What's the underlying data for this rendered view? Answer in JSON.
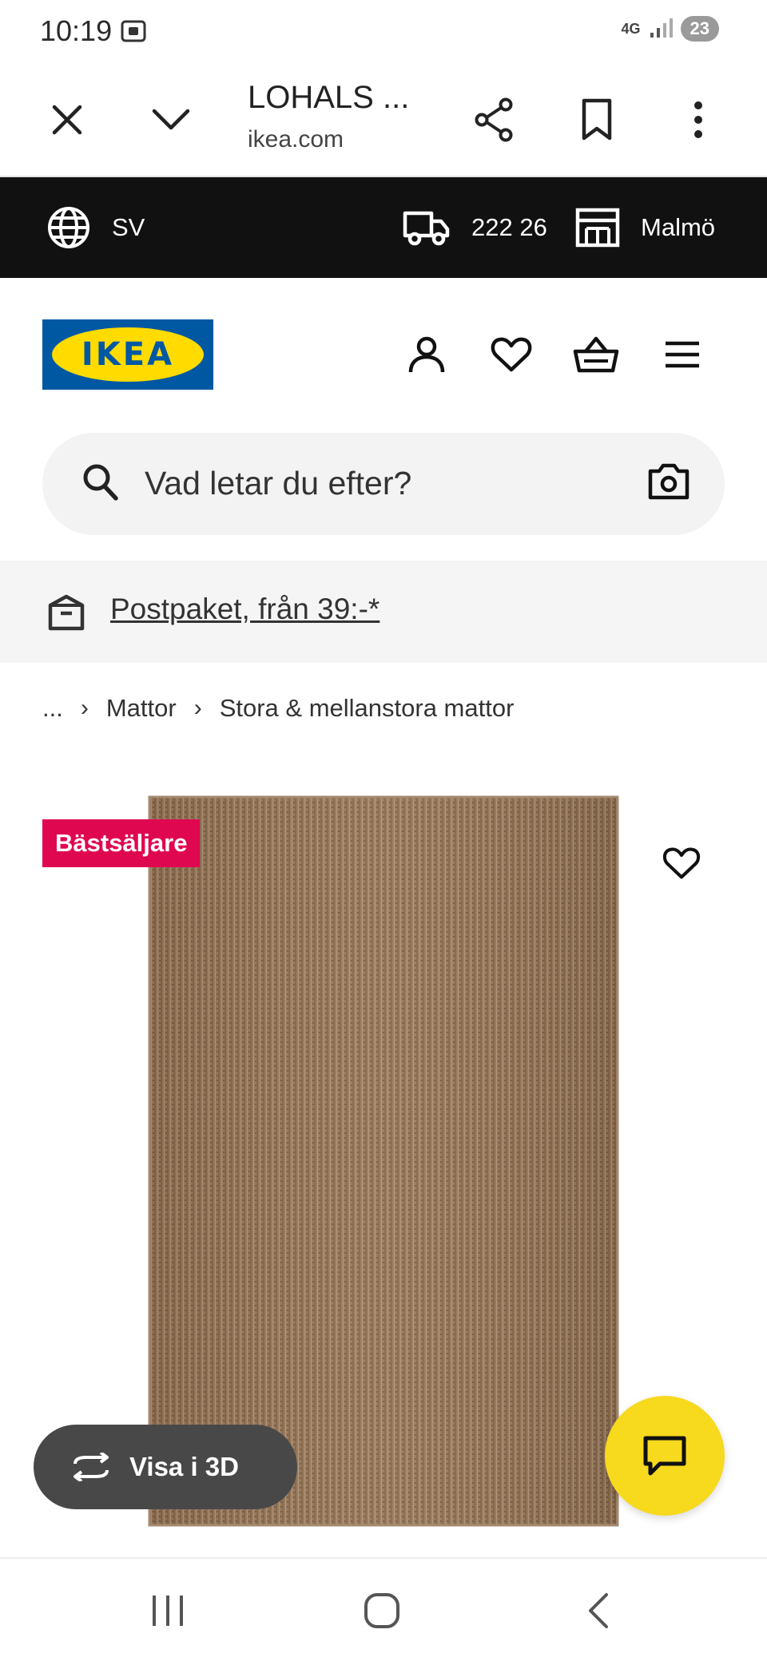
{
  "status_bar": {
    "time": "10:19",
    "network": "4G",
    "battery": "23"
  },
  "browser": {
    "title": "LOHALS ...",
    "domain": "ikea.com"
  },
  "locale_bar": {
    "language": "SV",
    "postcode": "222 26",
    "store": "Malmö"
  },
  "logo": {
    "text": "IKEA",
    "colors": {
      "blue": "#0058a3",
      "yellow": "#ffdb00"
    }
  },
  "search": {
    "placeholder": "Vad letar du efter?"
  },
  "promo": {
    "link": "Postpaket, från 39:-*"
  },
  "breadcrumb": {
    "ellipsis": "...",
    "items": [
      "Mattor",
      "Stora & mellanstora mattor"
    ]
  },
  "product": {
    "badge": "Bästsäljare",
    "view_3d_label": "Visa i 3D"
  },
  "colors": {
    "badge": "#e00751",
    "chat_button": "#f7d91e",
    "locale_bar": "#111111"
  },
  "icons": [
    "close-icon",
    "chevron-down-icon",
    "share-icon",
    "bookmark-icon",
    "more-vert-icon",
    "globe-icon",
    "truck-icon",
    "store-icon",
    "user-icon",
    "heart-icon",
    "basket-icon",
    "menu-icon",
    "search-icon",
    "camera-icon",
    "package-icon",
    "rotate-3d-icon",
    "chat-icon"
  ]
}
